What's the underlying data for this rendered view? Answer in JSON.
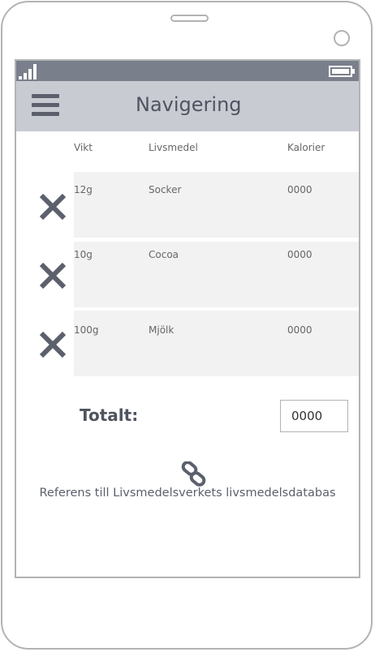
{
  "header": {
    "title": "Navigering"
  },
  "table": {
    "columns": {
      "weight": "Vikt",
      "food": "Livsmedel",
      "calories": "Kalorier"
    },
    "rows": [
      {
        "weight": "12g",
        "food": "Socker",
        "calories": "0000"
      },
      {
        "weight": "10g",
        "food": "Cocoa",
        "calories": "0000"
      },
      {
        "weight": "100g",
        "food": "Mjölk",
        "calories": "0000"
      }
    ]
  },
  "total": {
    "label": "Totalt:",
    "value": "0000"
  },
  "reference": {
    "text": "Referens till Livsmedelsverkets livsmedelsdatabas",
    "icon": "link-icon"
  },
  "icons": {
    "menu": "hamburger-menu-icon",
    "delete": "close-icon",
    "signal": "signal-icon",
    "battery": "battery-icon"
  },
  "colors": {
    "statusbar": "#7a7f8c",
    "appbar": "#c9cbd3",
    "row_bg": "#f2f2f2",
    "icon": "#5b606c"
  }
}
